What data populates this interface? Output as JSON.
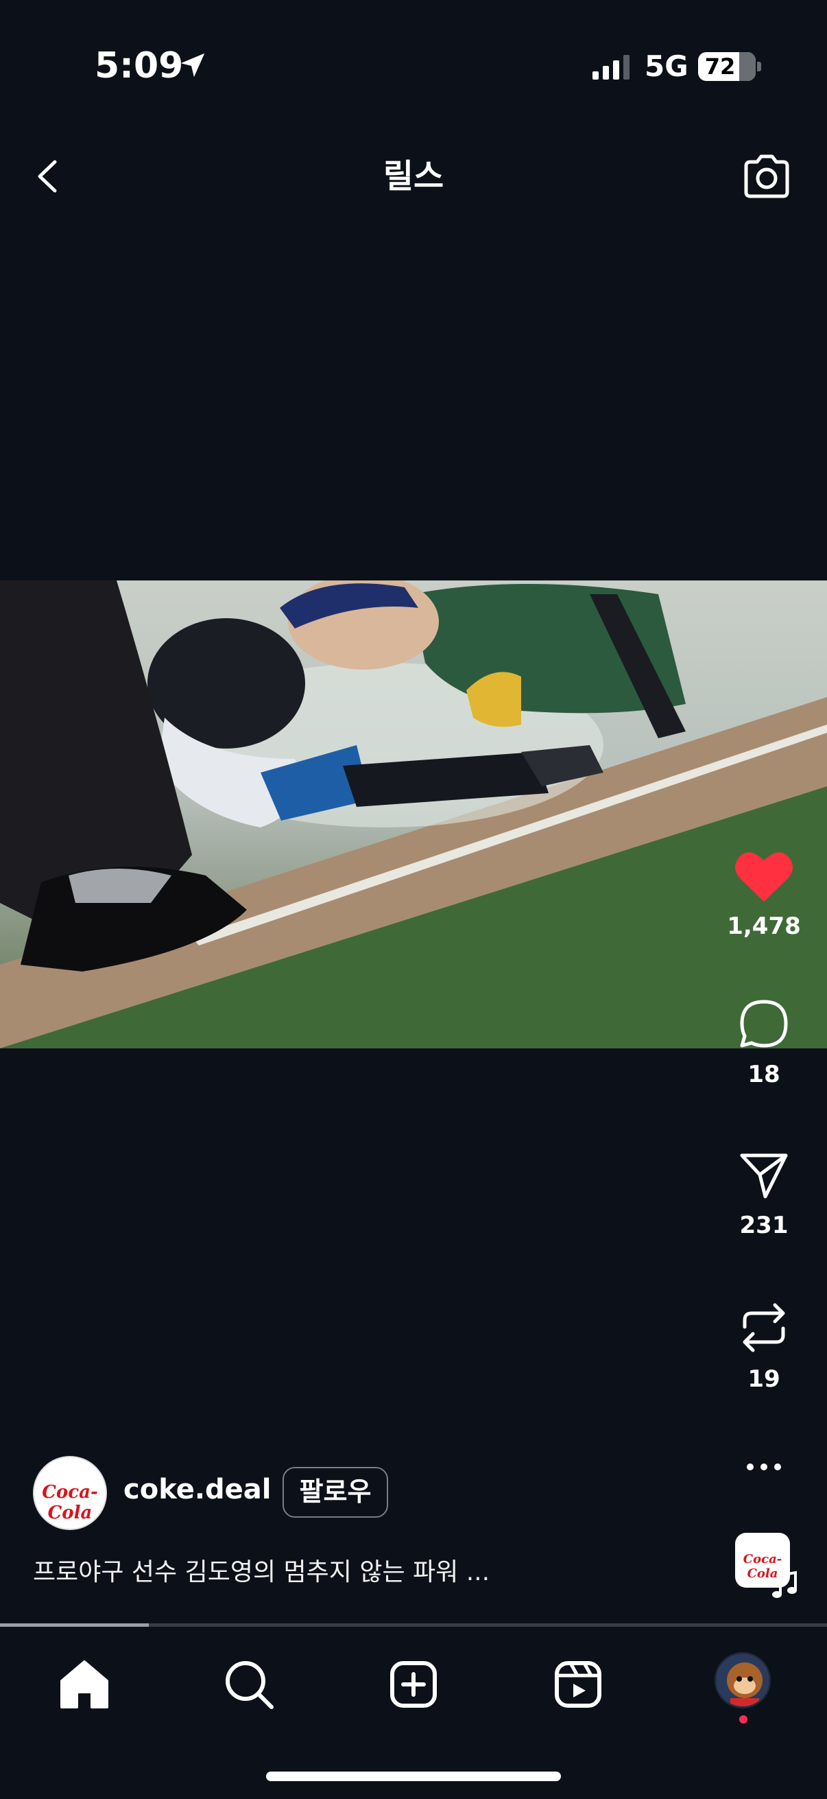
{
  "status_bar": {
    "time": "5:09",
    "network": "5G",
    "battery": "72",
    "battery_level": 0.72,
    "location_icon": "location-arrow-icon",
    "signal_icon": "cellular-signal-icon"
  },
  "header": {
    "title": "릴스",
    "back_icon": "chevron-left-icon",
    "camera_icon": "camera-icon"
  },
  "video": {
    "description_icon": "video-frame"
  },
  "actions": {
    "like": {
      "icon": "heart-filled-icon",
      "count": "1,478",
      "color": "#ff3040"
    },
    "comment": {
      "icon": "comment-bubble-icon",
      "count": "18"
    },
    "share": {
      "icon": "paper-plane-icon",
      "count": "231"
    },
    "remix": {
      "icon": "repost-icon",
      "count": "19"
    },
    "more": {
      "icon": "more-horizontal-icon"
    }
  },
  "author": {
    "username": "coke.deal",
    "follow_label": "팔로우",
    "avatar_logo": "Coca-Cola",
    "caption": "프로야구 선수 김도영의 멈추지 않는 파워 ..."
  },
  "music": {
    "thumb_logo": "Coca-Cola",
    "icon": "music-note-icon"
  },
  "progress": {
    "fraction": 0.18
  },
  "bottom_nav": {
    "items": [
      {
        "name": "home",
        "icon": "home-icon"
      },
      {
        "name": "search",
        "icon": "search-icon"
      },
      {
        "name": "create",
        "icon": "add-square-icon"
      },
      {
        "name": "reels",
        "icon": "reels-icon"
      },
      {
        "name": "profile",
        "icon": "profile-avatar-icon"
      }
    ]
  },
  "colors": {
    "background": "#0c1018",
    "like_red": "#ff3040",
    "brand_red": "#d7141d"
  }
}
